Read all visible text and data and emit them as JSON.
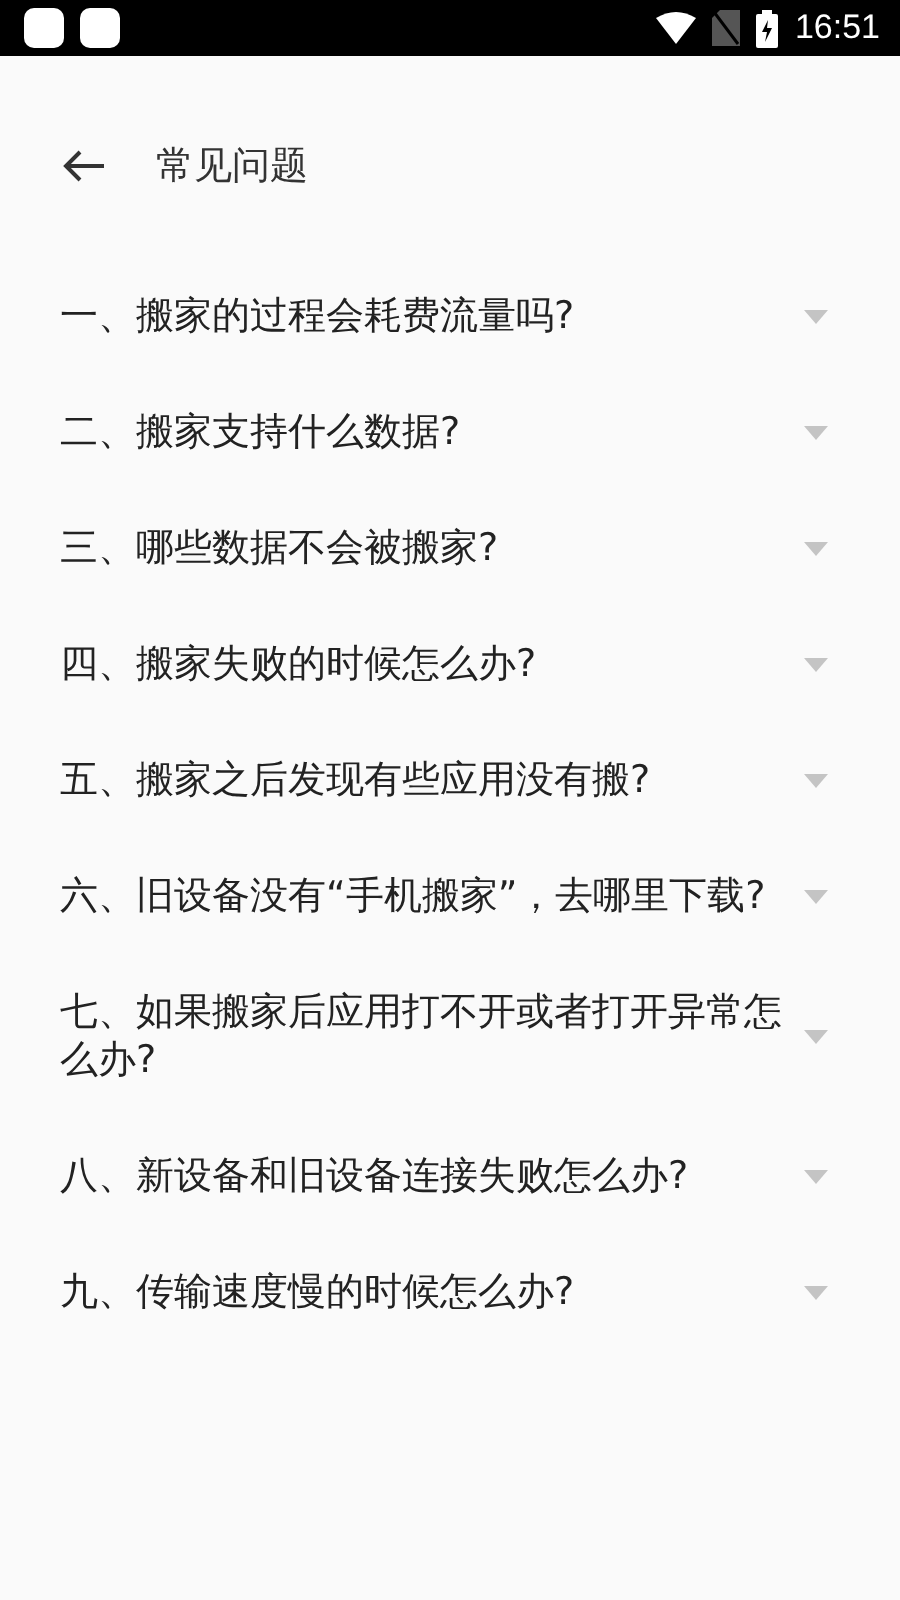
{
  "status_bar": {
    "time": "16:51"
  },
  "header": {
    "title": "常见问题"
  },
  "faq": [
    {
      "question": "一、搬家的过程会耗费流量吗?",
      "expanded": false
    },
    {
      "question": "二、搬家支持什么数据?",
      "expanded": false
    },
    {
      "question": "三、哪些数据不会被搬家?",
      "expanded": false
    },
    {
      "question": "四、搬家失败的时候怎么办?",
      "expanded": false
    },
    {
      "question": "五、搬家之后发现有些应用没有搬?",
      "expanded": false
    },
    {
      "question": "六、旧设备没有“手机搬家”，去哪里下载?",
      "expanded": false
    },
    {
      "question": "七、如果搬家后应用打不开或者打开异常怎么办?",
      "expanded": false
    },
    {
      "question": "八、新设备和旧设备连接失败怎么办?",
      "expanded": false
    },
    {
      "question": "九、传输速度慢的时候怎么办?",
      "expanded": false
    }
  ]
}
